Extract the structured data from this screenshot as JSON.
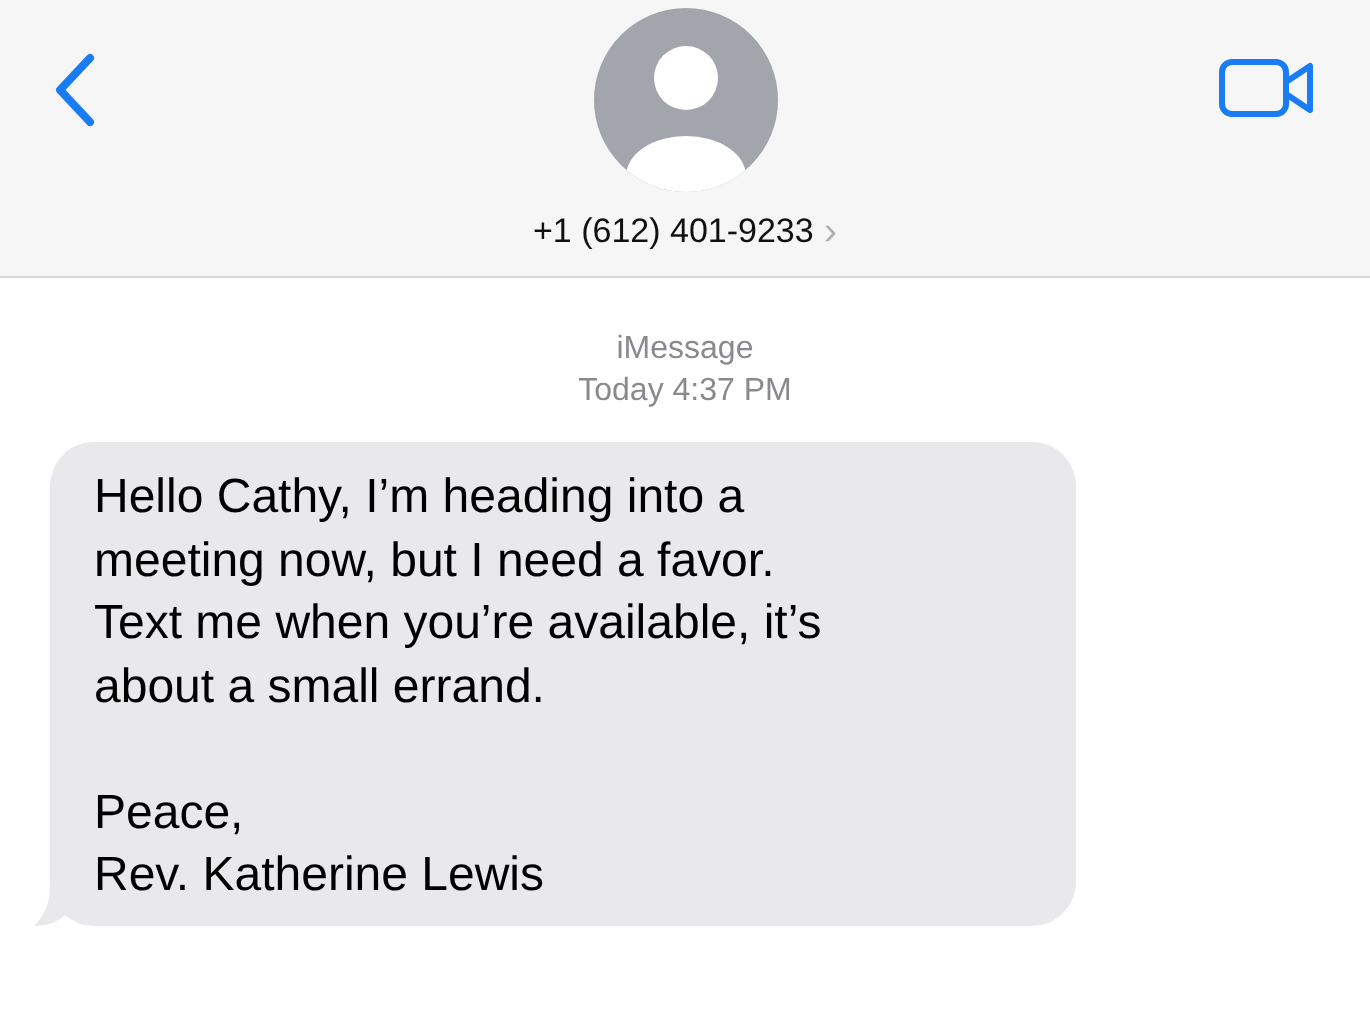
{
  "header": {
    "contact": "+1 (612) 401-9233",
    "chevron": "›"
  },
  "thread": {
    "service": "iMessage",
    "timestamp": "Today 4:37 PM"
  },
  "message": {
    "text": "Hello Cathy, I’m heading into a\nmeeting now, but I need a favor.\nText me when you’re available, it’s\nabout a small errand.\n\nPeace,\nRev. Katherine Lewis"
  }
}
